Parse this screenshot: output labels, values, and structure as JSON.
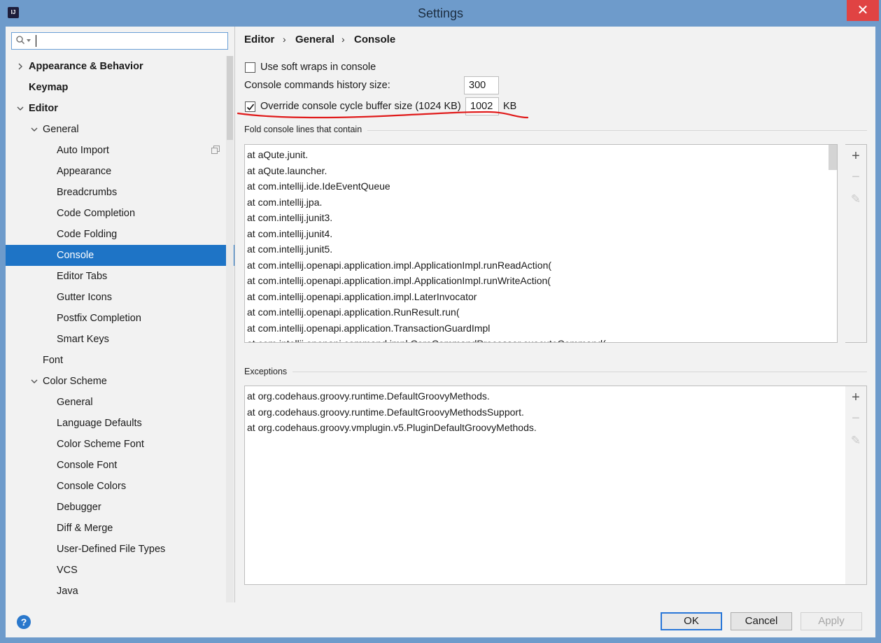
{
  "window": {
    "title": "Settings",
    "close_glyph": "✕",
    "app_icon_text": "IJ"
  },
  "search": {
    "value": "",
    "placeholder": ""
  },
  "tree": [
    {
      "label": "Appearance & Behavior",
      "expanded": false,
      "bold": true
    },
    {
      "label": "Keymap",
      "bold": true
    },
    {
      "label": "Editor",
      "expanded": true,
      "bold": true
    },
    {
      "label": "General",
      "expanded": true
    },
    {
      "label": "Auto Import"
    },
    {
      "label": "Appearance"
    },
    {
      "label": "Breadcrumbs"
    },
    {
      "label": "Code Completion"
    },
    {
      "label": "Code Folding"
    },
    {
      "label": "Console",
      "selected": true
    },
    {
      "label": "Editor Tabs"
    },
    {
      "label": "Gutter Icons"
    },
    {
      "label": "Postfix Completion"
    },
    {
      "label": "Smart Keys"
    },
    {
      "label": "Font"
    },
    {
      "label": "Color Scheme",
      "expanded": true
    },
    {
      "label": "General"
    },
    {
      "label": "Language Defaults"
    },
    {
      "label": "Color Scheme Font"
    },
    {
      "label": "Console Font"
    },
    {
      "label": "Console Colors"
    },
    {
      "label": "Debugger"
    },
    {
      "label": "Diff & Merge"
    },
    {
      "label": "User-Defined File Types"
    },
    {
      "label": "VCS"
    },
    {
      "label": "Java"
    }
  ],
  "breadcrumb": [
    "Editor",
    "General",
    "Console"
  ],
  "breadcrumb_sep": "›",
  "settings": {
    "soft_wraps_label": "Use soft wraps in console",
    "soft_wraps_checked": false,
    "history_label": "Console commands history size:",
    "history_value": "300",
    "override_label": "Override console cycle buffer size (1024 KB)",
    "override_checked": true,
    "override_value": "1002",
    "override_unit": "KB"
  },
  "fold_section": {
    "title": "Fold console lines that contain",
    "items": [
      "at aQute.junit.",
      "at aQute.launcher.",
      "at com.intellij.ide.IdeEventQueue",
      "at com.intellij.jpa.",
      "at com.intellij.junit3.",
      "at com.intellij.junit4.",
      "at com.intellij.junit5.",
      "at com.intellij.openapi.application.impl.ApplicationImpl.runReadAction(",
      "at com.intellij.openapi.application.impl.ApplicationImpl.runWriteAction(",
      "at com.intellij.openapi.application.impl.LaterInvocator",
      "at com.intellij.openapi.application.RunResult.run(",
      "at com.intellij.openapi.application.TransactionGuardImpl",
      "at com.intellij.openapi.command.impl.CoreCommandProcessor.executeCommand("
    ]
  },
  "exceptions_section": {
    "title": "Exceptions",
    "items": [
      "at org.codehaus.groovy.runtime.DefaultGroovyMethods.",
      "at org.codehaus.groovy.runtime.DefaultGroovyMethodsSupport.",
      "at org.codehaus.groovy.vmplugin.v5.PluginDefaultGroovyMethods."
    ]
  },
  "list_toolbar": {
    "add": "+",
    "remove": "−",
    "edit": "✎"
  },
  "buttons": {
    "help": "?",
    "ok": "OK",
    "cancel": "Cancel",
    "apply": "Apply"
  },
  "colors": {
    "selection": "#1e74c6",
    "title_bar": "#6e9bcb",
    "annotation": "#e01b1b"
  }
}
